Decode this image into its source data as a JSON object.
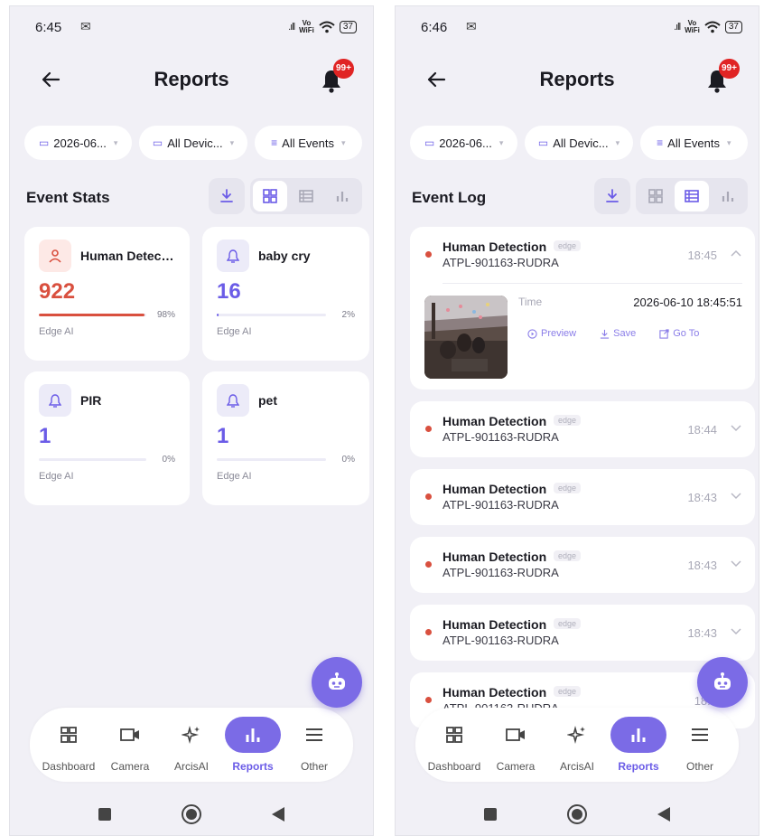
{
  "colors": {
    "accent": "#6b5ce7",
    "danger": "#d9503f",
    "background": "#f1f0f6"
  },
  "screens": {
    "left": {
      "status": {
        "time": "6:45",
        "signal": ".ıll",
        "vowifi_top": "Vo",
        "vowifi_bottom": "WiFi",
        "battery": "37"
      },
      "title": "Reports",
      "notification_badge": "99+",
      "filters": {
        "date": "2026-06...",
        "device": "All Devic...",
        "events": "All Events"
      },
      "section_title": "Event Stats",
      "stats": [
        {
          "name": "Human Detecti...",
          "count": "922",
          "percent_label": "98%",
          "percent": 98,
          "source": "Edge AI",
          "icon": "person-icon"
        },
        {
          "name": "baby cry",
          "count": "16",
          "percent_label": "2%",
          "percent": 2,
          "source": "Edge AI",
          "icon": "bell-icon"
        },
        {
          "name": "PIR",
          "count": "1",
          "percent_label": "0%",
          "percent": 0,
          "source": "Edge AI",
          "icon": "bell-icon"
        },
        {
          "name": "pet",
          "count": "1",
          "percent_label": "0%",
          "percent": 0,
          "source": "Edge AI",
          "icon": "bell-icon"
        }
      ]
    },
    "right": {
      "status": {
        "time": "6:46",
        "signal": ".ıll",
        "vowifi_top": "Vo",
        "vowifi_bottom": "WiFi",
        "battery": "37"
      },
      "title": "Reports",
      "notification_badge": "99+",
      "filters": {
        "date": "2026-06...",
        "device": "All Devic...",
        "events": "All Events"
      },
      "section_title": "Event Log",
      "events": [
        {
          "name": "Human Detection",
          "tag": "edge",
          "device": "ATPL-901163-RUDRA",
          "time": "18:45",
          "expanded": true,
          "detail_label": "Time",
          "detail_value": "2026-06-10 18:45:51",
          "actions": {
            "preview": "Preview",
            "save": "Save",
            "goto": "Go To"
          }
        },
        {
          "name": "Human Detection",
          "tag": "edge",
          "device": "ATPL-901163-RUDRA",
          "time": "18:44"
        },
        {
          "name": "Human Detection",
          "tag": "edge",
          "device": "ATPL-901163-RUDRA",
          "time": "18:43"
        },
        {
          "name": "Human Detection",
          "tag": "edge",
          "device": "ATPL-901163-RUDRA",
          "time": "18:43"
        },
        {
          "name": "Human Detection",
          "tag": "edge",
          "device": "ATPL-901163-RUDRA",
          "time": "18:43"
        },
        {
          "name": "Human Detection",
          "tag": "edge",
          "device": "ATPL-901163-RUDRA",
          "time": "18:4"
        }
      ]
    }
  },
  "nav": {
    "items": [
      {
        "label": "Dashboard",
        "icon": "dashboard-icon"
      },
      {
        "label": "Camera",
        "icon": "camera-icon"
      },
      {
        "label": "ArcisAI",
        "icon": "sparkle-icon"
      },
      {
        "label": "Reports",
        "icon": "chart-icon",
        "active": true
      },
      {
        "label": "Other",
        "icon": "menu-icon"
      }
    ]
  }
}
